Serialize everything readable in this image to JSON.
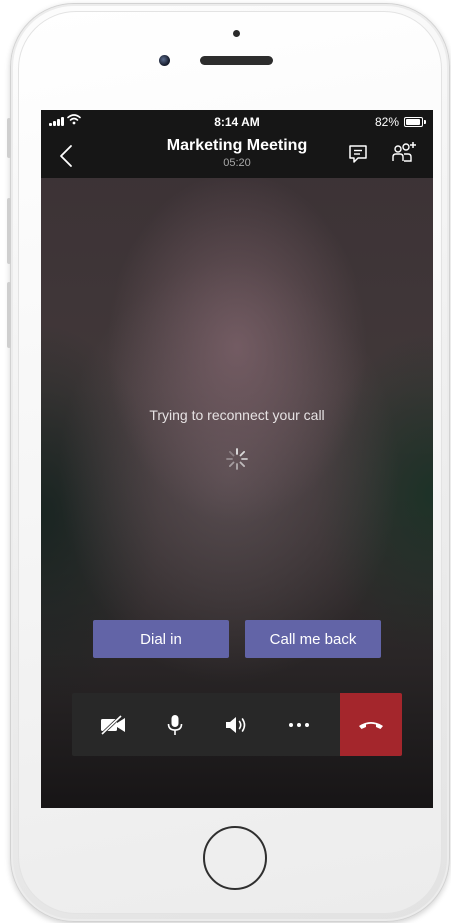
{
  "status_bar": {
    "time": "8:14 AM",
    "battery": "82%"
  },
  "header": {
    "title": "Marketing Meeting",
    "duration": "05:20"
  },
  "call": {
    "message": "Trying to reconnect your call"
  },
  "actions": {
    "dial_in": "Dial in",
    "call_me_back": "Call me back"
  },
  "controls": {
    "items": [
      "video-off-icon",
      "microphone-icon",
      "speaker-icon",
      "more-options-icon",
      "hang-up-icon"
    ]
  },
  "colors": {
    "accent": "#6264a7",
    "hangup": "#a4262c",
    "control_bar": "#282828",
    "top_bar": "#161616"
  }
}
